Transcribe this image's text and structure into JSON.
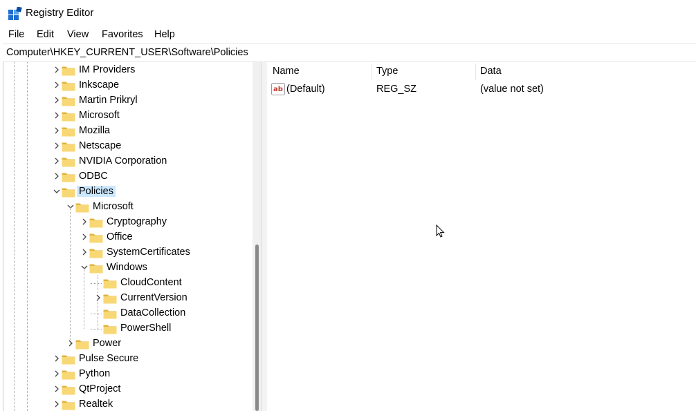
{
  "window": {
    "title": "Registry Editor"
  },
  "menu": [
    "File",
    "Edit",
    "View",
    "Favorites",
    "Help"
  ],
  "address": "Computer\\HKEY_CURRENT_USER\\Software\\Policies",
  "tree": [
    {
      "label": "IM Providers",
      "level": 0,
      "chevron": "right"
    },
    {
      "label": "Inkscape",
      "level": 0,
      "chevron": "right"
    },
    {
      "label": "Martin Prikryl",
      "level": 0,
      "chevron": "right"
    },
    {
      "label": "Microsoft",
      "level": 0,
      "chevron": "right"
    },
    {
      "label": "Mozilla",
      "level": 0,
      "chevron": "right"
    },
    {
      "label": "Netscape",
      "level": 0,
      "chevron": "right"
    },
    {
      "label": "NVIDIA Corporation",
      "level": 0,
      "chevron": "right"
    },
    {
      "label": "ODBC",
      "level": 0,
      "chevron": "right"
    },
    {
      "label": "Policies",
      "level": 0,
      "chevron": "down",
      "selected": true
    },
    {
      "label": "Microsoft",
      "level": 1,
      "chevron": "down"
    },
    {
      "label": "Cryptography",
      "level": 2,
      "chevron": "right"
    },
    {
      "label": "Office",
      "level": 2,
      "chevron": "right"
    },
    {
      "label": "SystemCertificates",
      "level": 2,
      "chevron": "right"
    },
    {
      "label": "Windows",
      "level": 2,
      "chevron": "down"
    },
    {
      "label": "CloudContent",
      "level": 3,
      "chevron": "none"
    },
    {
      "label": "CurrentVersion",
      "level": 3,
      "chevron": "right"
    },
    {
      "label": "DataCollection",
      "level": 3,
      "chevron": "none"
    },
    {
      "label": "PowerShell",
      "level": 3,
      "chevron": "none"
    },
    {
      "label": "Power",
      "level": 1,
      "chevron": "right"
    },
    {
      "label": "Pulse Secure",
      "level": 0,
      "chevron": "right"
    },
    {
      "label": "Python",
      "level": 0,
      "chevron": "right"
    },
    {
      "label": "QtProject",
      "level": 0,
      "chevron": "right"
    },
    {
      "label": "Realtek",
      "level": 0,
      "chevron": "right"
    }
  ],
  "list": {
    "columns": [
      "Name",
      "Type",
      "Data"
    ],
    "rows": [
      {
        "name": "(Default)",
        "type": "REG_SZ",
        "data": "(value not set)",
        "icon": "string-value-icon"
      }
    ]
  },
  "colors": {
    "folder": "#f8d775",
    "folder_dark": "#e0b43c",
    "selection": "#cce8ff",
    "chevron": "#444444"
  }
}
